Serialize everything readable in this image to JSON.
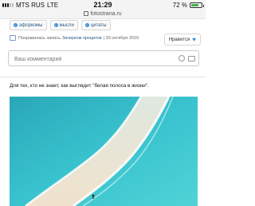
{
  "status_bar": {
    "carrier": "MTS RUS",
    "network": "LTE",
    "time": "21:29",
    "battery_percent": "72 %",
    "battery_level": 0.72
  },
  "browser": {
    "url": "fotostrana.ru"
  },
  "tags": [
    "афоризмы",
    "мысли",
    "цитаты"
  ],
  "share": {
    "prefix": "Понравилась запись",
    "author": "Зачерком процитов",
    "date": "| 30 октября 2016"
  },
  "like_button": {
    "label": "Нравится"
  },
  "comment_box": {
    "placeholder": "Ваш комментарий"
  },
  "post": {
    "text": "Для тех, кто не знает, как выглядит \"белая полоса в жизни\"."
  },
  "colors": {
    "link": "#2a5a86",
    "accent": "#3b8bd6",
    "sea": "#2fb8c6",
    "sand": "#efe3cf"
  }
}
